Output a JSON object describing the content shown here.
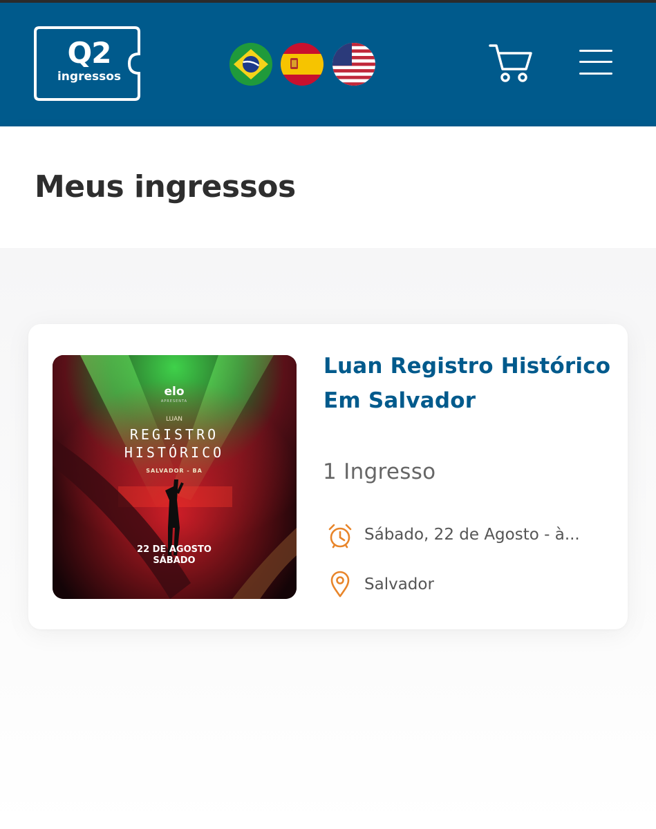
{
  "header": {
    "logo": {
      "title": "Q2",
      "subtitle": "ingressos"
    },
    "languages": [
      {
        "code": "pt-BR",
        "icon": "brazil-flag-icon"
      },
      {
        "code": "es",
        "icon": "spain-flag-icon"
      },
      {
        "code": "en-US",
        "icon": "usa-flag-icon"
      }
    ],
    "cart_icon": "shopping-cart-icon",
    "menu_icon": "hamburger-menu-icon",
    "colors": {
      "brand": "#005a8c"
    }
  },
  "page": {
    "title": "Meus ingressos"
  },
  "tickets": [
    {
      "poster": {
        "sponsor": "elo",
        "sponsor_sub": "APRESENTA",
        "artist": "LUAN",
        "title_line1": "REGISTRO",
        "title_line2": "HISTÓRICO",
        "location": "SALVADOR - BA",
        "date_line1": "22 DE AGOSTO",
        "date_line2": "SÁBADO"
      },
      "title": "Luan Registro Histórico Em Salvador",
      "count": "1 Ingresso",
      "date": "Sábado, 22 de Agosto - à...",
      "city": "Salvador",
      "date_icon": "alarm-clock-icon",
      "city_icon": "map-pin-icon",
      "accent": "#e8852a"
    }
  ]
}
